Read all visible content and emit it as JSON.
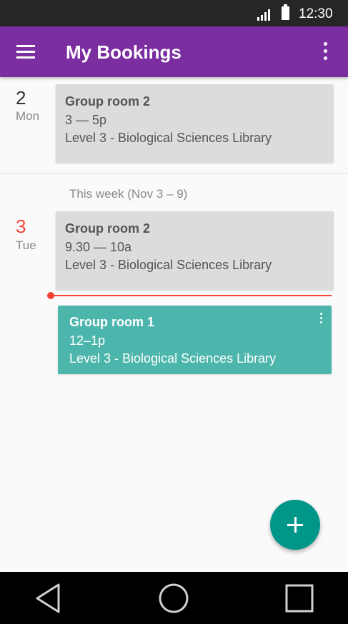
{
  "status": {
    "time": "12:30"
  },
  "appbar": {
    "title": "My Bookings"
  },
  "days": [
    {
      "num": "2",
      "name": "Mon"
    },
    {
      "num": "3",
      "name": "Tue"
    }
  ],
  "week_label": "This week (Nov 3 – 9)",
  "bookings": [
    {
      "room": "Group room 2",
      "time": "3 — 5p",
      "location": "Level 3 - Biological Sciences Library"
    },
    {
      "room": "Group room 2",
      "time": "9.30 — 10a",
      "location": "Level 3 - Biological Sciences Library"
    },
    {
      "room": "Group room 1",
      "time": "12–1p",
      "location": "Level 3 - Biological Sciences Library"
    }
  ],
  "colors": {
    "primary": "#7b2ea0",
    "accent": "#009688",
    "active_card": "#4db6ac",
    "today": "#f44336"
  },
  "icons": {
    "menu": "menu-icon",
    "more": "more-vert-icon",
    "add": "add-icon",
    "back": "back-icon",
    "home": "home-icon",
    "recents": "recents-icon"
  }
}
